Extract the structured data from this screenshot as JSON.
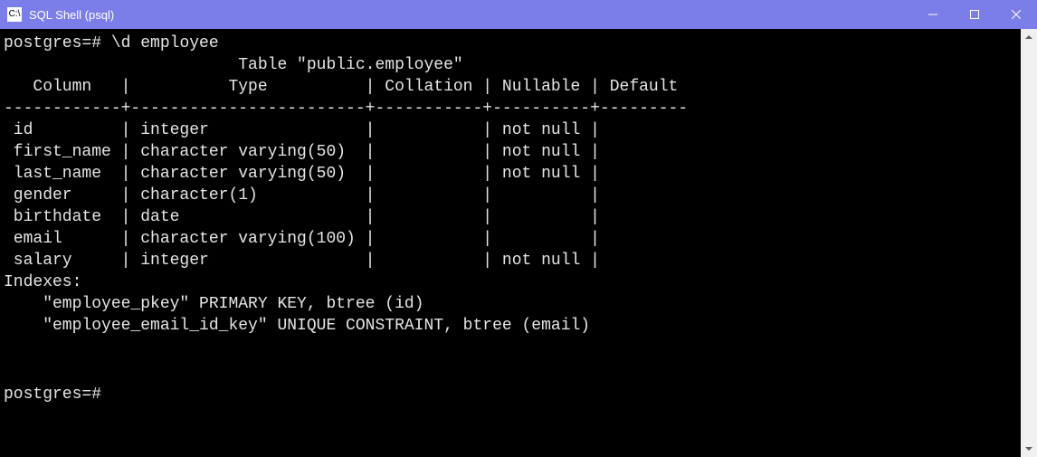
{
  "window": {
    "title": "SQL Shell (psql)"
  },
  "terminal": {
    "prompt1": "postgres=# ",
    "command1": "\\d employee",
    "table_header_line": "                        Table \"public.employee\"",
    "col_header": "   Column   |          Type          | Collation | Nullable | Default",
    "separator": "------------+------------------------+-----------+----------+---------",
    "rows": [
      " id         | integer                |           | not null |",
      " first_name | character varying(50)  |           | not null |",
      " last_name  | character varying(50)  |           | not null |",
      " gender     | character(1)           |           |          |",
      " birthdate  | date                   |           |          |",
      " email      | character varying(100) |           |          |",
      " salary     | integer                |           | not null |"
    ],
    "indexes_label": "Indexes:",
    "index1": "    \"employee_pkey\" PRIMARY KEY, btree (id)",
    "index2": "    \"employee_email_id_key\" UNIQUE CONSTRAINT, btree (email)",
    "blank": "",
    "prompt2": "postgres=#"
  }
}
